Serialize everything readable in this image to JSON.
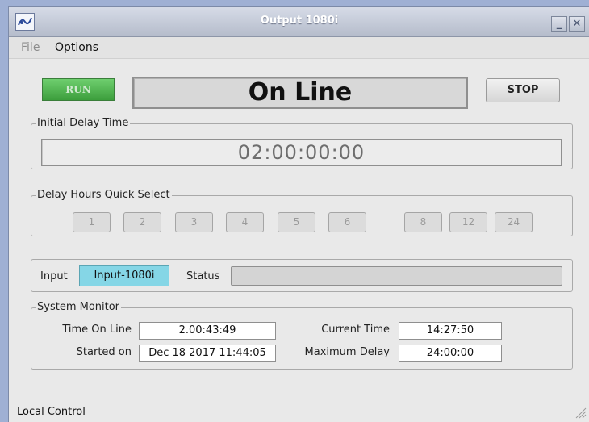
{
  "window": {
    "title": "Output 1080i",
    "minimize_label": "_",
    "close_label": "✕"
  },
  "menu": {
    "file": "File",
    "options": "Options"
  },
  "controls": {
    "run_label": "RUN",
    "status_text": "On Line",
    "stop_label": "STOP"
  },
  "initial_delay": {
    "label": "Initial Delay Time",
    "value": "02:00:00:00"
  },
  "quick_select": {
    "label": "Delay Hours Quick Select",
    "buttons": [
      "1",
      "2",
      "3",
      "4",
      "5",
      "6",
      "8",
      "12",
      "24"
    ]
  },
  "input_status": {
    "input_label": "Input",
    "input_value": "Input-1080i",
    "status_label": "Status",
    "status_value": ""
  },
  "system_monitor": {
    "label": "System Monitor",
    "time_on_line_label": "Time On Line",
    "time_on_line_value": "2.00:43:49",
    "started_on_label": "Started on",
    "started_on_value": "Dec 18 2017 11:44:05",
    "current_time_label": "Current Time",
    "current_time_value": "14:27:50",
    "maximum_delay_label": "Maximum Delay",
    "maximum_delay_value": "24:00:00"
  },
  "footer": {
    "control_mode": "Local Control"
  },
  "colors": {
    "run_button": "#4caf50",
    "input_badge": "#85d6e6",
    "desktop": "#9fb0d4"
  }
}
